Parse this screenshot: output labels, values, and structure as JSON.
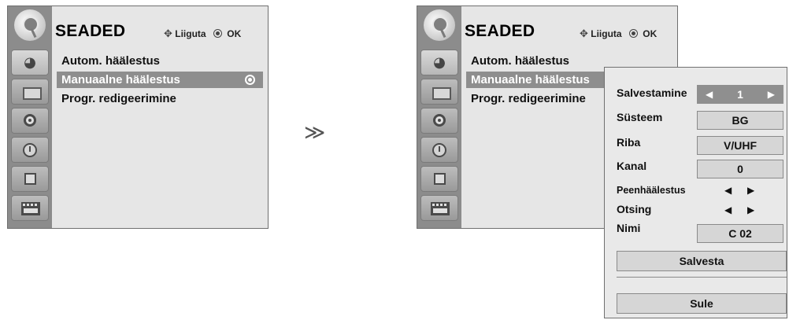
{
  "left_panel": {
    "title": "SEADED",
    "hint_move": "Liiguta",
    "hint_ok": "OK",
    "menu": [
      {
        "label": "Autom. häälestus",
        "selected": false
      },
      {
        "label": "Manuaalne häälestus",
        "selected": true
      },
      {
        "label": "Progr. redigeerimine",
        "selected": false
      }
    ]
  },
  "right_panel": {
    "title": "SEADED",
    "hint_move": "Liiguta",
    "hint_ok": "OK",
    "menu": [
      {
        "label": "Autom. häälestus",
        "selected": false
      },
      {
        "label": "Manuaalne häälestus",
        "selected": true
      },
      {
        "label": "Progr. redigeerimine",
        "selected": false
      }
    ]
  },
  "sidebar_icons": [
    "satellite-icon",
    "picture-icon",
    "audio-icon",
    "time-icon",
    "lock-icon",
    "clapboard-icon"
  ],
  "arrow": "≫",
  "popup": {
    "rows": [
      {
        "label": "Salvestamine",
        "value": "1",
        "type": "stepper"
      },
      {
        "label": "Süsteem",
        "value": "BG",
        "type": "field"
      },
      {
        "label": "Riba",
        "value": "V/UHF",
        "type": "field"
      },
      {
        "label": "Kanal",
        "value": "0",
        "type": "field"
      },
      {
        "label": "Peenhäälestus",
        "type": "arrows"
      },
      {
        "label": "Otsing",
        "type": "arrows"
      },
      {
        "label": "Nimi",
        "value": "C  02",
        "type": "field"
      }
    ],
    "save_label": "Salvesta",
    "close_label": "Sule"
  },
  "colors": {
    "panel_bg": "#e6e6e6",
    "sidebar_bg": "#8c8c8c",
    "selected_bg": "#8e8e8e",
    "popup_bg": "#e9e9e9"
  }
}
